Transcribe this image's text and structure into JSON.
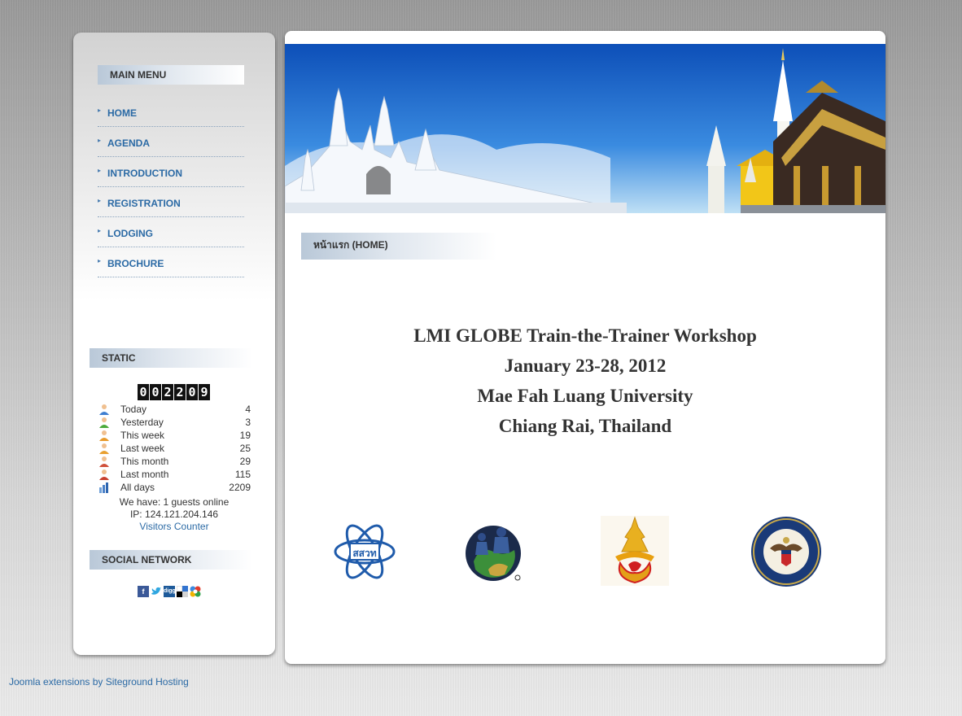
{
  "main_menu": {
    "title": "MAIN MENU",
    "items": [
      "HOME",
      "AGENDA",
      "INTRODUCTION",
      "REGISTRATION",
      "LODGING",
      "BROCHURE"
    ]
  },
  "static_module": {
    "title": "STATIC",
    "counter_digits": [
      "0",
      "0",
      "2",
      "2",
      "0",
      "9"
    ],
    "rows": [
      {
        "label": "Today",
        "value": "4",
        "icon": "user-blue-icon"
      },
      {
        "label": "Yesterday",
        "value": "3",
        "icon": "user-green-icon"
      },
      {
        "label": "This week",
        "value": "19",
        "icon": "user-orange-icon"
      },
      {
        "label": "Last week",
        "value": "25",
        "icon": "user-orange-icon"
      },
      {
        "label": "This month",
        "value": "29",
        "icon": "user-red-icon"
      },
      {
        "label": "Last month",
        "value": "115",
        "icon": "user-red-icon"
      },
      {
        "label": "All days",
        "value": "2209",
        "icon": "bar-chart-icon"
      }
    ],
    "guests_online": "We have: 1 guests online",
    "ip": "IP: 124.121.204.146",
    "visitors_link": "Visitors Counter"
  },
  "social_network": {
    "title": "SOCIAL NETWORK",
    "icons": [
      "facebook-icon",
      "twitter-icon",
      "digg-icon",
      "delicious-icon",
      "google-icon"
    ]
  },
  "content": {
    "page_heading": "หน้าแรก (HOME)",
    "lines": [
      "LMI GLOBE Train-the-Trainer Workshop",
      "January 23-28, 2012",
      "Mae Fah Luang University",
      "Chiang Rai, Thailand"
    ],
    "logos": {
      "ipst_text": "สสวท"
    }
  },
  "footer": {
    "link": "Joomla extensions by Siteground Hosting"
  },
  "colors": {
    "link": "#2b6aa5",
    "text": "#333333"
  }
}
